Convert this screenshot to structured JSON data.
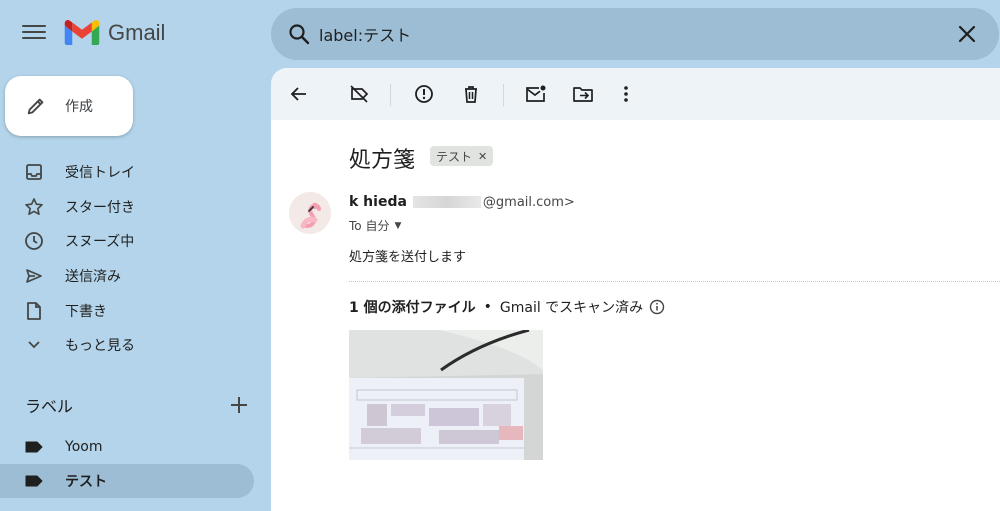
{
  "header": {
    "app_name": "Gmail",
    "search_value": "label:テスト"
  },
  "sidebar": {
    "compose_label": "作成",
    "items": [
      {
        "label": "受信トレイ",
        "icon": "inbox-icon"
      },
      {
        "label": "スター付き",
        "icon": "star-icon"
      },
      {
        "label": "スヌーズ中",
        "icon": "clock-icon"
      },
      {
        "label": "送信済み",
        "icon": "send-icon"
      },
      {
        "label": "下書き",
        "icon": "draft-icon"
      },
      {
        "label": "もっと見る",
        "icon": "chevron-down-icon"
      }
    ],
    "labels_title": "ラベル",
    "labels": [
      {
        "label": "Yoom",
        "icon": "label-icon"
      },
      {
        "label": "テスト",
        "icon": "label-icon"
      }
    ]
  },
  "message": {
    "subject": "処方箋",
    "tag": "テスト",
    "sender_name": "k hieda",
    "sender_email": "@gmail.com>",
    "to": "To 自分",
    "body": "処方箋を送付します",
    "attachment_count": "1 個の添付ファイル",
    "scan_status": "Gmail でスキャン済み"
  },
  "colors": {
    "background": "#b3d4ea",
    "search_bg": "#9cbdd3",
    "active_label_bg": "#9cbdd3",
    "toolbar_bg": "#eef3f8"
  }
}
